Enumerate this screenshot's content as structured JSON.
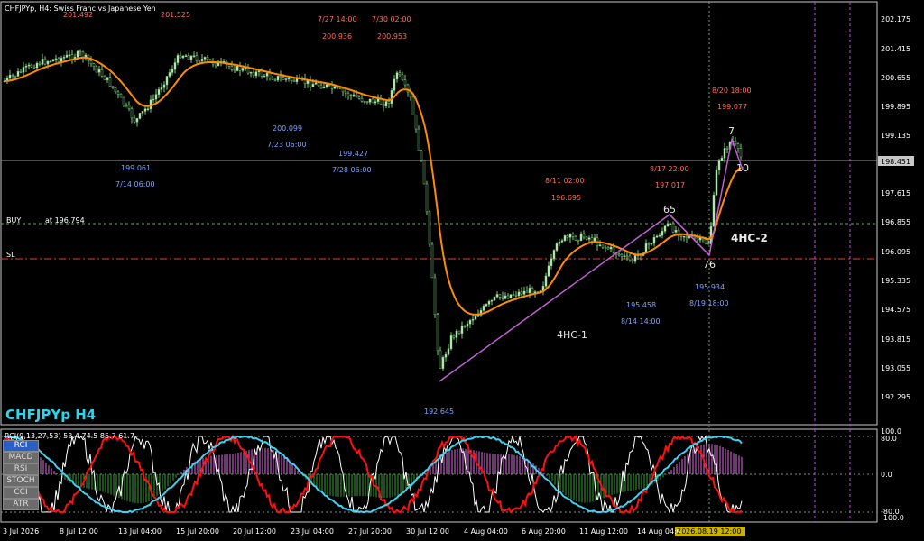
{
  "chart_header": "CHFJPYp, H4:  Swiss Franc vs Japanese Yen",
  "symbol_tag": "CHFJPYp H4",
  "current_price": "198.451",
  "price_scale": [
    "202.175",
    "201.415",
    "200.655",
    "199.895",
    "199.135",
    "198.451",
    "197.615",
    "196.855",
    "196.095",
    "195.335",
    "194.575",
    "193.815",
    "193.055",
    "192.295"
  ],
  "time_scale": [
    "3 Jul 2026",
    "8 Jul 12:00",
    "13 Jul 04:00",
    "15 Jul 20:00",
    "20 Jul 12:00",
    "23 Jul 04:00",
    "27 Jul 20:00",
    "30 Jul 12:00",
    "4 Aug 04:00",
    "6 Aug 20:00",
    "11 Aug 12:00",
    "14 Aug 04:00"
  ],
  "time_highlight": "2026.08.19 12:00",
  "lines": {
    "buy": "BUY",
    "buy_at": "at 196.794",
    "sl": "SL"
  },
  "annotations_top": [
    {
      "text": "201.492",
      "cls": "red"
    },
    {
      "text": "201.525",
      "cls": "red"
    },
    {
      "text": "7/27 14:00",
      "cls": "red"
    },
    {
      "text": "200.936",
      "cls": "red"
    },
    {
      "text": "7/30 02:00",
      "cls": "red"
    },
    {
      "text": "200.953",
      "cls": "red"
    },
    {
      "text": "200.099",
      "cls": "blue"
    },
    {
      "text": "7/23 06:00",
      "cls": "blue"
    },
    {
      "text": "199.427",
      "cls": "blue"
    },
    {
      "text": "7/28 06:00",
      "cls": "blue"
    },
    {
      "text": "199.061",
      "cls": "blue"
    },
    {
      "text": "7/14 06:00",
      "cls": "blue"
    },
    {
      "text": "8/11 02:00",
      "cls": "red"
    },
    {
      "text": "196.695",
      "cls": "red"
    },
    {
      "text": "8/17 22:00",
      "cls": "red"
    },
    {
      "text": "197.017",
      "cls": "red"
    },
    {
      "text": "8/20 18:00",
      "cls": "red"
    },
    {
      "text": "199.077",
      "cls": "red"
    },
    {
      "text": "195.458",
      "cls": "blue"
    },
    {
      "text": "8/14 14:00",
      "cls": "blue"
    },
    {
      "text": "195.934",
      "cls": "blue"
    },
    {
      "text": "8/19 18:00",
      "cls": "blue"
    },
    {
      "text": "192.645",
      "cls": "blue"
    }
  ],
  "waves": {
    "w65": "65",
    "w76": "76",
    "w7": "7",
    "w10": "10",
    "hc1": "4HC-1",
    "hc2": "4HC-2"
  },
  "indicator": {
    "title": "RCI(9,13,27,53) 53.4 74.5 85.7 61.7",
    "buttons": [
      "RCI",
      "MACD",
      "RSI",
      "STOCH",
      "CCI",
      "ATR"
    ],
    "scale": [
      "100.0",
      "80.0",
      "0.0",
      "-80.0",
      "-100.0"
    ]
  },
  "colors": {
    "ma": "#ff8c00",
    "wave": "#c060d0",
    "buy": "#4caf50",
    "sl": "#e04040",
    "rci_cyan": "#40d0f0",
    "rci_red": "#ff1010",
    "hist": "#e070e0",
    "hist_green": "#3ca03c"
  }
}
